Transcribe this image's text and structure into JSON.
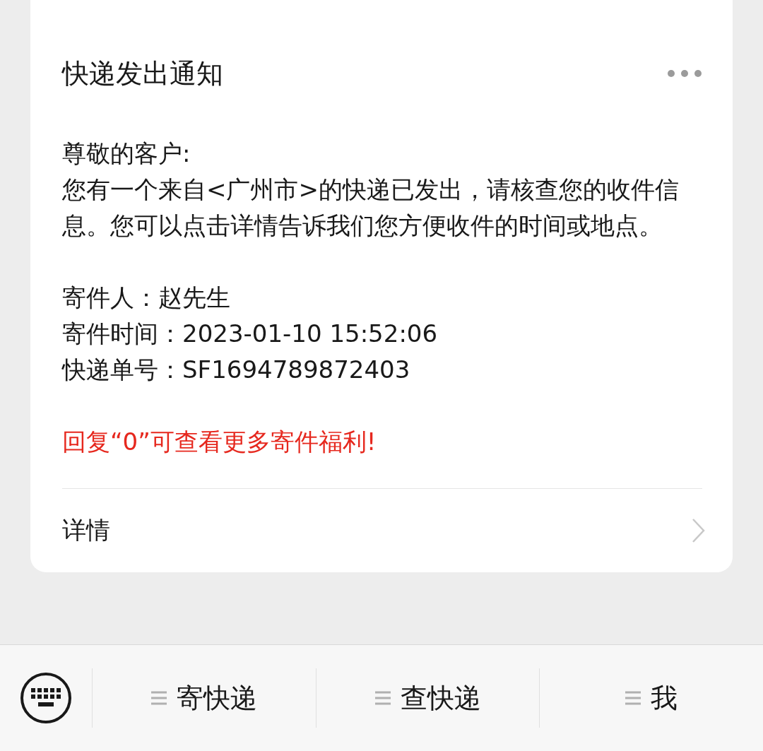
{
  "card": {
    "title": "快递发出通知",
    "greeting": "尊敬的客户:",
    "message": "您有一个来自<广州市>的快递已发出，请核查您的收件信息。您可以点击详情告诉我们您方便收件的时间或地点。",
    "fields": [
      {
        "label": "寄件人：",
        "value": "赵先生"
      },
      {
        "label": "寄件时间：",
        "value": "2023-01-10 15:52:06"
      },
      {
        "label": "快递单号：",
        "value": "SF1694789872403"
      }
    ],
    "promo": "回复“0”可查看更多寄件福利!",
    "details_link": "详情"
  },
  "menu_bar": {
    "items": [
      {
        "label": "寄快递"
      },
      {
        "label": "查快递"
      },
      {
        "label": "我"
      }
    ]
  }
}
